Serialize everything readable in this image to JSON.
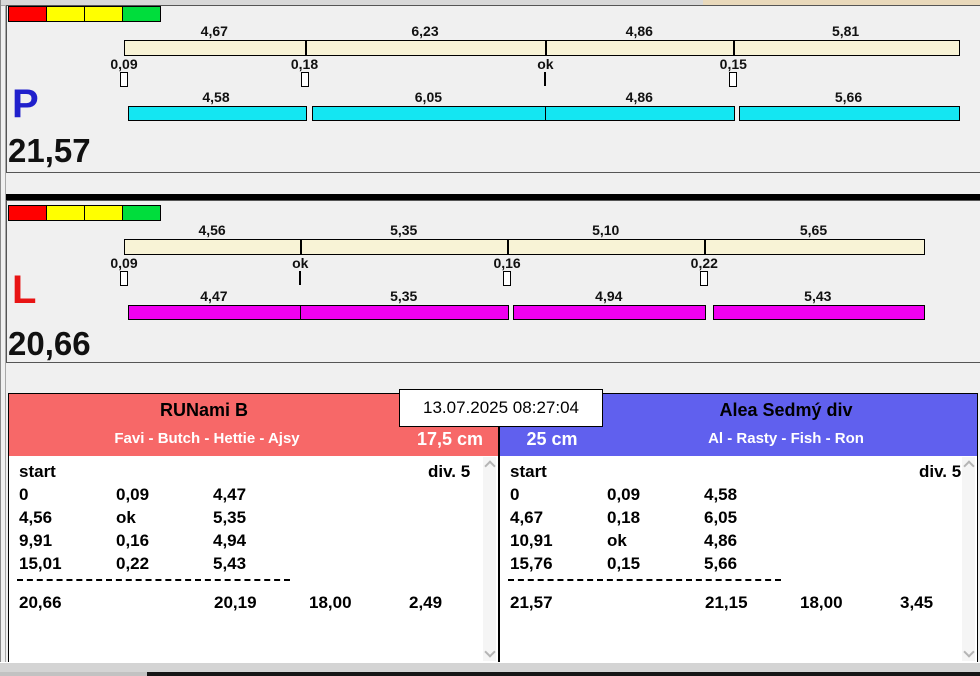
{
  "window": {
    "timestamp": "13.07.2025 08:27:04"
  },
  "colors": {
    "cream_bar": "#f8f3d6",
    "status_squares": [
      "#ff0000",
      "#ffff00",
      "#ffff00",
      "#00dd3c"
    ]
  },
  "lanes": [
    {
      "letter": "P",
      "letter_color": "#2020cc",
      "total": "21,57",
      "net_color": "#14e6f2",
      "gross_segments": [
        "4,67",
        "6,23",
        "4,86",
        "5,81"
      ],
      "changeovers": [
        {
          "label": "0,09",
          "ok": false
        },
        {
          "label": "0,18",
          "ok": false
        },
        {
          "label": "ok",
          "ok": true
        },
        {
          "label": "0,15",
          "ok": false
        }
      ],
      "net_segments": [
        "4,58",
        "6,05",
        "4,86",
        "5,66"
      ]
    },
    {
      "letter": "L",
      "letter_color": "#e81414",
      "total": "20,66",
      "net_color": "#f000f0",
      "gross_segments": [
        "4,56",
        "5,35",
        "5,10",
        "5,65"
      ],
      "changeovers": [
        {
          "label": "0,09",
          "ok": false
        },
        {
          "label": "ok",
          "ok": true
        },
        {
          "label": "0,16",
          "ok": false
        },
        {
          "label": "0,22",
          "ok": false
        }
      ],
      "net_segments": [
        "4,47",
        "5,35",
        "4,94",
        "5,43"
      ]
    }
  ],
  "teams": [
    {
      "name": "RUNami B",
      "members": "Favi - Butch - Hettie - Ajsy",
      "height": "17,5 cm",
      "header_color": "#f76868",
      "start_label": "start",
      "division": "div.  5",
      "rows": [
        [
          "0",
          "0,09",
          "4,47"
        ],
        [
          "4,56",
          "ok",
          "5,35"
        ],
        [
          "9,91",
          "0,16",
          "4,94"
        ],
        [
          "15,01",
          "0,22",
          "5,43"
        ]
      ],
      "totals": [
        "20,66",
        "20,19",
        "18,00",
        "2,49"
      ]
    },
    {
      "name": "Alea Sedmý div",
      "members": "Al - Rasty - Fish - Ron",
      "height": "25 cm",
      "header_color": "#6060ee",
      "start_label": "start",
      "division": "div.  5",
      "rows": [
        [
          "0",
          "0,09",
          "4,58"
        ],
        [
          "4,67",
          "0,18",
          "6,05"
        ],
        [
          "10,91",
          "ok",
          "4,86"
        ],
        [
          "15,76",
          "0,15",
          "5,66"
        ]
      ],
      "totals": [
        "21,57",
        "21,15",
        "18,00",
        "3,45"
      ]
    }
  ]
}
